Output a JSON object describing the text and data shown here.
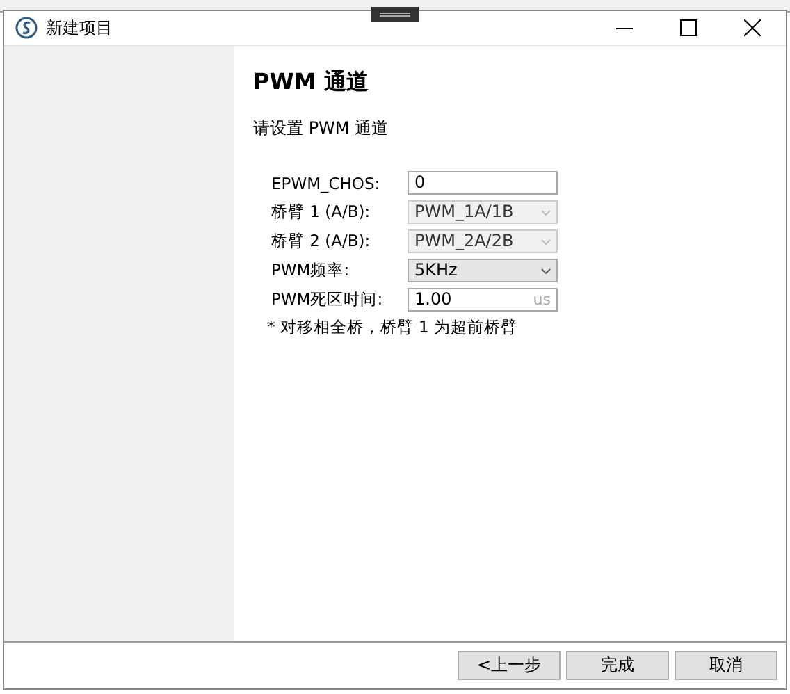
{
  "window": {
    "title": "新建项目"
  },
  "heading": "PWM 通道",
  "subtitle": "请设置 PWM 通道",
  "fields": [
    {
      "kind": "text",
      "label": "EPWM_CHOS:",
      "value": "0",
      "disabled": false
    },
    {
      "kind": "combo",
      "label": "桥臂 1 (A/B):",
      "value": "PWM_1A/1B",
      "disabled": true
    },
    {
      "kind": "combo",
      "label": "桥臂 2 (A/B):",
      "value": "PWM_2A/2B",
      "disabled": true
    },
    {
      "kind": "combo",
      "label": "PWM频率:",
      "value": "5KHz",
      "disabled": false
    },
    {
      "kind": "unit",
      "label": "PWM死区时间:",
      "value": "1.00",
      "unit": "us",
      "disabled": false
    }
  ],
  "note": "* 对移相全桥，桥臂 1 为超前桥臂",
  "buttons": [
    {
      "label": "<上一步"
    },
    {
      "label": "完成"
    },
    {
      "label": "取消"
    }
  ]
}
